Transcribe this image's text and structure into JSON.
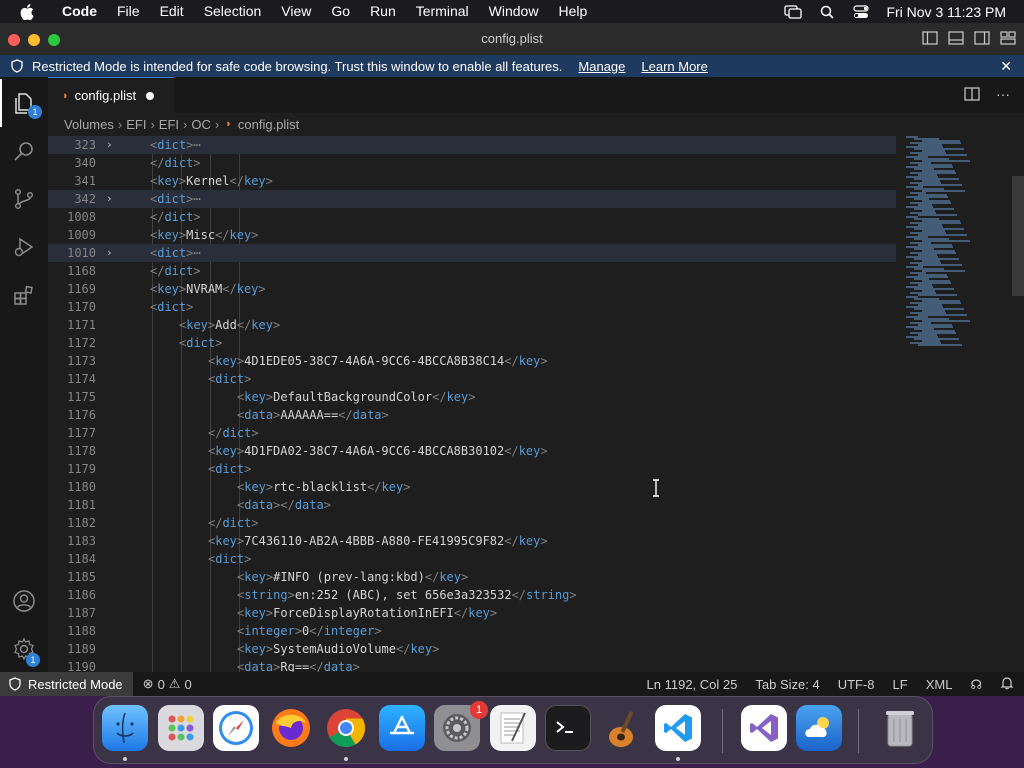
{
  "menubar": {
    "app": "Code",
    "items": [
      "File",
      "Edit",
      "Selection",
      "View",
      "Go",
      "Run",
      "Terminal",
      "Window",
      "Help"
    ],
    "clock": "Fri Nov 3  11:23 PM"
  },
  "window": {
    "title": "config.plist"
  },
  "banner": {
    "message": "Restricted Mode is intended for safe code browsing. Trust this window to enable all features.",
    "manage": "Manage",
    "learn_more": "Learn More"
  },
  "activity": {
    "explorer_badge": "1",
    "accounts_badge": "1"
  },
  "tab": {
    "label": "config.plist"
  },
  "breadcrumb": [
    "Volumes",
    "EFI",
    "EFI",
    "OC",
    "config.plist"
  ],
  "editor": {
    "lines": [
      {
        "n": "323",
        "indent": 1,
        "folded": true,
        "tag": "dict",
        "text": "",
        "close": false,
        "collapsed": true
      },
      {
        "n": "340",
        "indent": 1,
        "tag": "dict",
        "close": true
      },
      {
        "n": "341",
        "indent": 1,
        "tag": "key",
        "text": "Kernel",
        "pair": true
      },
      {
        "n": "342",
        "indent": 1,
        "folded": true,
        "tag": "dict",
        "collapsed": true
      },
      {
        "n": "1008",
        "indent": 1,
        "tag": "dict",
        "close": true
      },
      {
        "n": "1009",
        "indent": 1,
        "tag": "key",
        "text": "Misc",
        "pair": true
      },
      {
        "n": "1010",
        "indent": 1,
        "folded": true,
        "tag": "dict",
        "collapsed": true
      },
      {
        "n": "1168",
        "indent": 1,
        "tag": "dict",
        "close": true
      },
      {
        "n": "1169",
        "indent": 1,
        "tag": "key",
        "text": "NVRAM",
        "pair": true
      },
      {
        "n": "1170",
        "indent": 1,
        "tag": "dict"
      },
      {
        "n": "1171",
        "indent": 2,
        "tag": "key",
        "text": "Add",
        "pair": true
      },
      {
        "n": "1172",
        "indent": 2,
        "tag": "dict"
      },
      {
        "n": "1173",
        "indent": 3,
        "tag": "key",
        "text": "4D1EDE05-38C7-4A6A-9CC6-4BCCA8B38C14",
        "pair": true
      },
      {
        "n": "1174",
        "indent": 3,
        "tag": "dict"
      },
      {
        "n": "1175",
        "indent": 4,
        "tag": "key",
        "text": "DefaultBackgroundColor",
        "pair": true
      },
      {
        "n": "1176",
        "indent": 4,
        "tag": "data",
        "text": "AAAAAA==",
        "pair": true
      },
      {
        "n": "1177",
        "indent": 3,
        "tag": "dict",
        "close": true
      },
      {
        "n": "1178",
        "indent": 3,
        "tag": "key",
        "text": "4D1FDA02-38C7-4A6A-9CC6-4BCCA8B30102",
        "pair": true
      },
      {
        "n": "1179",
        "indent": 3,
        "tag": "dict"
      },
      {
        "n": "1180",
        "indent": 4,
        "tag": "key",
        "text": "rtc-blacklist",
        "pair": true
      },
      {
        "n": "1181",
        "indent": 4,
        "tag": "data",
        "text": "",
        "pair": true
      },
      {
        "n": "1182",
        "indent": 3,
        "tag": "dict",
        "close": true
      },
      {
        "n": "1183",
        "indent": 3,
        "tag": "key",
        "text": "7C436110-AB2A-4BBB-A880-FE41995C9F82",
        "pair": true
      },
      {
        "n": "1184",
        "indent": 3,
        "tag": "dict"
      },
      {
        "n": "1185",
        "indent": 4,
        "tag": "key",
        "text": "#INFO (prev-lang:kbd)",
        "pair": true
      },
      {
        "n": "1186",
        "indent": 4,
        "tag": "string",
        "text": "en:252 (ABC), set 656e3a323532",
        "pair": true
      },
      {
        "n": "1187",
        "indent": 4,
        "tag": "key",
        "text": "ForceDisplayRotationInEFI",
        "pair": true
      },
      {
        "n": "1188",
        "indent": 4,
        "tag": "integer",
        "text": "0",
        "pair": true
      },
      {
        "n": "1189",
        "indent": 4,
        "tag": "key",
        "text": "SystemAudioVolume",
        "pair": true
      },
      {
        "n": "1190",
        "indent": 4,
        "tag": "data",
        "text": "Rg==",
        "pair": true
      }
    ]
  },
  "statusbar": {
    "restricted": "Restricted Mode",
    "errors": "0",
    "warnings": "0",
    "position": "Ln 1192, Col 25",
    "tab_size": "Tab Size: 4",
    "encoding": "UTF-8",
    "eol": "LF",
    "language": "XML"
  },
  "dock": {
    "settings_badge": "1",
    "apps": [
      "finder-icon",
      "launchpad-icon",
      "safari-icon",
      "firefox-icon",
      "chrome-icon",
      "app-store-icon",
      "system-settings-icon",
      "textedit-icon",
      "terminal-icon",
      "garageband-icon",
      "vscode-icon",
      "visual-studio-icon",
      "weather-icon",
      "trash-icon"
    ]
  },
  "colors": {
    "accent": "#3c7fd1",
    "banner": "#1f3a5f",
    "tag_name": "#569cd6"
  }
}
